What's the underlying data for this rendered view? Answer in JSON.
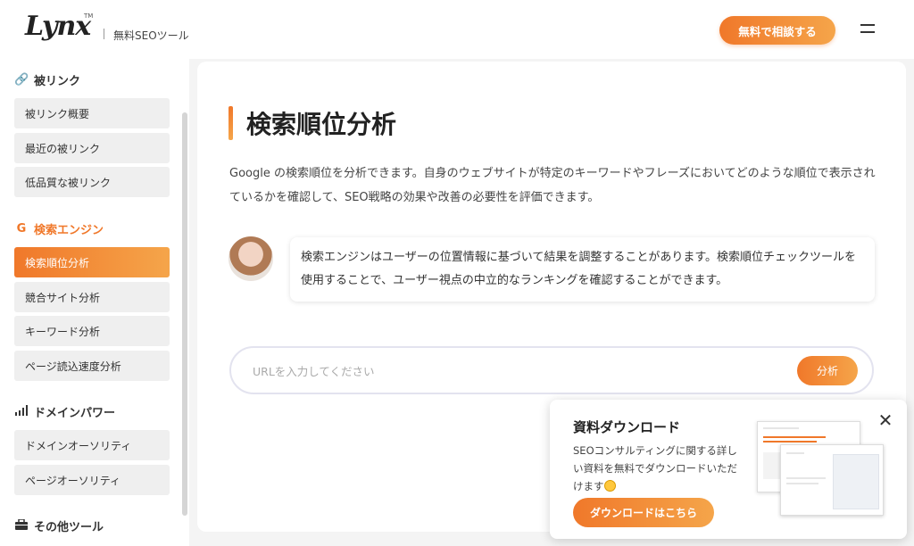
{
  "header": {
    "logo": "Lynx",
    "logo_tm": "TM",
    "subtitle": "無料SEOツール",
    "cta_label": "無料で相談する"
  },
  "sidebar": {
    "sections": [
      {
        "title": "被リンク",
        "icon": "link-icon",
        "items": [
          "被リンク概要",
          "最近の被リンク",
          "低品質な被リンク"
        ]
      },
      {
        "title": "検索エンジン",
        "icon": "google-icon",
        "active": true,
        "items": [
          "検索順位分析",
          "競合サイト分析",
          "キーワード分析",
          "ページ読込速度分析"
        ],
        "active_item": "検索順位分析"
      },
      {
        "title": "ドメインパワー",
        "icon": "signal-icon",
        "items": [
          "ドメインオーソリティ",
          "ページオーソリティ"
        ]
      },
      {
        "title": "その他ツール",
        "icon": "toolbox-icon",
        "items": []
      }
    ]
  },
  "main": {
    "title": "検索順位分析",
    "description": "Google の検索順位を分析できます。自身のウェブサイトが特定のキーワードやフレーズにおいてどのような順位で表示されているかを確認して、SEO戦略の効果や改善の必要性を評価できます。",
    "tip": "検索エンジンはユーザーの位置情報に基づいて結果を調整することがあります。検索順位チェックツールを使用することで、ユーザー視点の中立的なランキングを確認することができます。",
    "url_placeholder": "URLを入力してください",
    "analyze_label": "分析"
  },
  "popup": {
    "title": "資料ダウンロード",
    "text": "SEOコンサルティングに関する詳しい資料を無料でダウンロードいただけます",
    "button_label": "ダウンロードはこちら",
    "close": "✕"
  },
  "colors": {
    "accent": "#f0782a",
    "accent_light": "#f5a54a"
  }
}
